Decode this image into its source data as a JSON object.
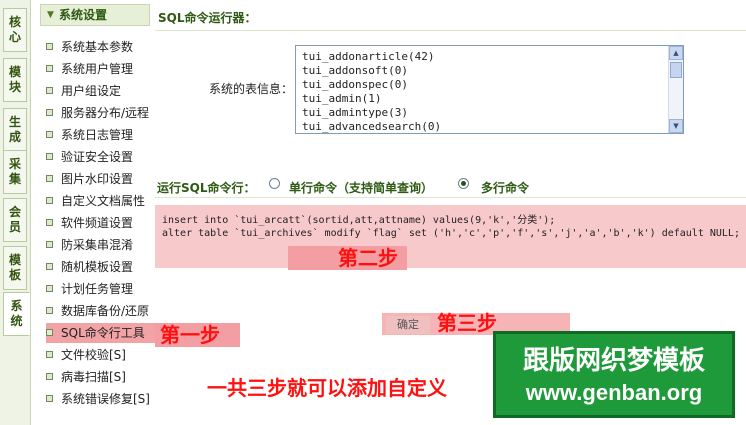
{
  "vtabs": [
    "核心",
    "模块",
    "生成",
    "采集",
    "会员",
    "模板",
    "系统"
  ],
  "sidebar": {
    "header": "系统设置",
    "items": [
      "系统基本参数",
      "系统用户管理",
      "用户组设定",
      "服务器分布/远程",
      "系统日志管理",
      "验证安全设置",
      "图片水印设置",
      "自定义文档属性",
      "软件频道设置",
      "防采集串混淆",
      "随机模板设置",
      "计划任务管理",
      "数据库备份/还原",
      "SQL命令行工具",
      "文件校验[S]",
      "病毒扫描[S]",
      "系统错误修复[S]"
    ]
  },
  "main": {
    "title": "SQL命令运行器：",
    "tables_label": "系统的表信息：",
    "tables": [
      "tui_addonarticle(42)",
      "tui_addonsoft(0)",
      "tui_addonspec(0)",
      "tui_admin(1)",
      "tui_admintype(3)",
      "tui_advancedsearch(0)"
    ],
    "mode_label": "运行SQL命令行：",
    "mode_single": "单行命令（支持简单查询）",
    "mode_multi": "多行命令",
    "sql_lines": [
      "insert into `tui_arcatt`(sortid,att,attname) values(9,'k','分类');",
      "alter table `tui_archives` modify `flag` set ('h','c','p','f','s','j','a','b','k') default NULL;"
    ],
    "confirm": "确定"
  },
  "annotations": {
    "step1": "第一步",
    "step2": "第二步",
    "step3": "第三步",
    "summary": "一共三步就可以添加自定义"
  },
  "watermark": {
    "line1": "跟版网织梦模板",
    "line2": "www.genban.org"
  }
}
